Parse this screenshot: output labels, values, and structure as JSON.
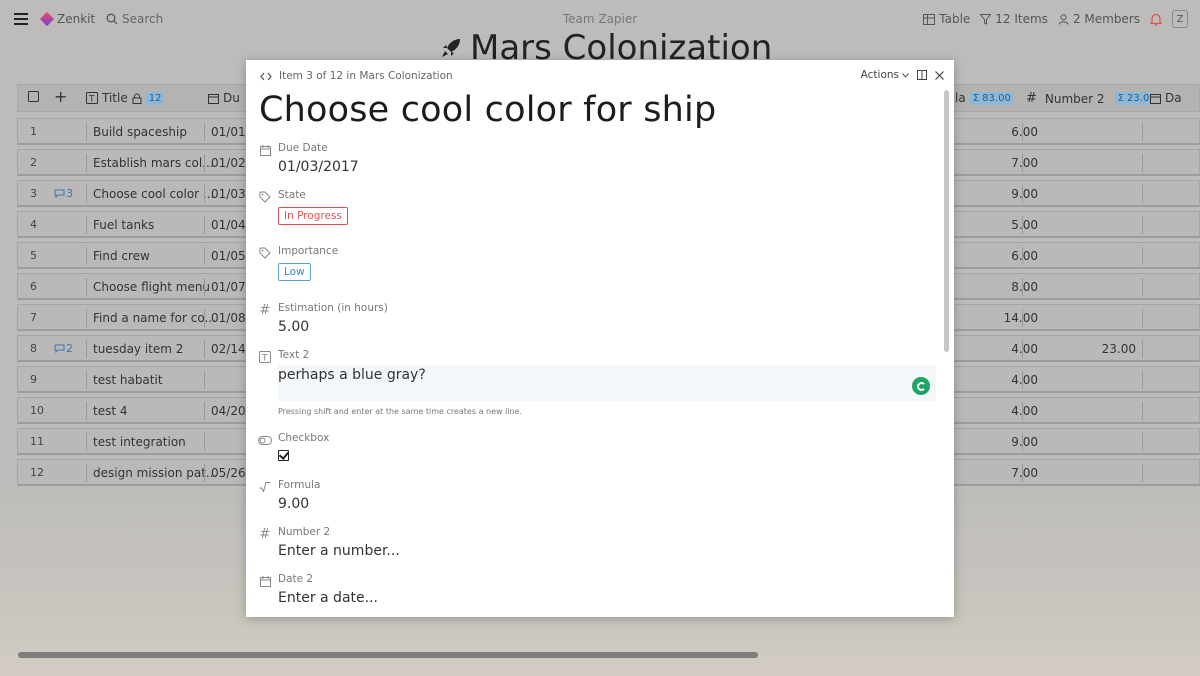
{
  "topbar": {
    "app_name": "Zenkit",
    "search_label": "Search",
    "workspace": "Team Zapier",
    "view_label": "Table",
    "items_label": "12 Items",
    "members_label": "2 Members",
    "user_initial": "Z"
  },
  "page": {
    "title": "Mars Colonization"
  },
  "table": {
    "headers": {
      "title": "Title",
      "title_count": "12",
      "due": "Du",
      "formula_suffix": "la",
      "formula_sum": "Σ 83.00",
      "number2": "Number 2",
      "number2_sum": "Σ 23.0",
      "date2": "Da"
    },
    "rows": [
      {
        "num": "1",
        "comments": "",
        "title": "Build spaceship",
        "due": "01/01/",
        "formula": "6.00",
        "number2": ""
      },
      {
        "num": "2",
        "comments": "",
        "title": "Establish mars col...",
        "due": "01/02/",
        "formula": "7.00",
        "number2": ""
      },
      {
        "num": "3",
        "comments": "3",
        "title": "Choose cool color ...",
        "due": "01/03/",
        "formula": "9.00",
        "number2": ""
      },
      {
        "num": "4",
        "comments": "",
        "title": "Fuel tanks",
        "due": "01/04/",
        "formula": "5.00",
        "number2": ""
      },
      {
        "num": "5",
        "comments": "",
        "title": "Find crew",
        "due": "01/05/",
        "formula": "6.00",
        "number2": ""
      },
      {
        "num": "6",
        "comments": "",
        "title": "Choose flight menu",
        "due": "01/07/",
        "formula": "8.00",
        "number2": ""
      },
      {
        "num": "7",
        "comments": "",
        "title": "Find a name for co...",
        "due": "01/08/",
        "formula": "14.00",
        "number2": ""
      },
      {
        "num": "8",
        "comments": "2",
        "title": "tuesday item 2",
        "due": "02/14/",
        "formula": "4.00",
        "number2": "23.00"
      },
      {
        "num": "9",
        "comments": "",
        "title": "test habatit",
        "due": "",
        "formula": "4.00",
        "number2": ""
      },
      {
        "num": "10",
        "comments": "",
        "title": "test 4",
        "due": "04/20/",
        "formula": "4.00",
        "number2": ""
      },
      {
        "num": "11",
        "comments": "",
        "title": "test integration",
        "due": "",
        "formula": "9.00",
        "number2": ""
      },
      {
        "num": "12",
        "comments": "",
        "title": "design mission pat...",
        "due": "05/26/",
        "formula": "7.00",
        "number2": ""
      }
    ]
  },
  "modal": {
    "breadcrumb": "Item 3 of 12 in Mars Colonization",
    "actions_label": "Actions",
    "title": "Choose cool color for ship",
    "fields": {
      "due_date": {
        "label": "Due Date",
        "value": "01/03/2017"
      },
      "state": {
        "label": "State",
        "value": "In Progress"
      },
      "importance": {
        "label": "Importance",
        "value": "Low"
      },
      "estimation": {
        "label": "Estimation (in hours)",
        "value": "5.00"
      },
      "text2": {
        "label": "Text 2",
        "value": "perhaps a blue gray?",
        "hint": "Pressing shift and enter at the same time creates a new line."
      },
      "checkbox": {
        "label": "Checkbox",
        "checked": true
      },
      "formula": {
        "label": "Formula",
        "value": "9.00"
      },
      "number2": {
        "label": "Number 2",
        "placeholder": "Enter a number..."
      },
      "date2": {
        "label": "Date 2",
        "placeholder": "Enter a date..."
      }
    }
  },
  "colors": {
    "state_tag": "#e05050",
    "importance_tag": "#3c87c6",
    "grammarly": "#1fa463"
  }
}
